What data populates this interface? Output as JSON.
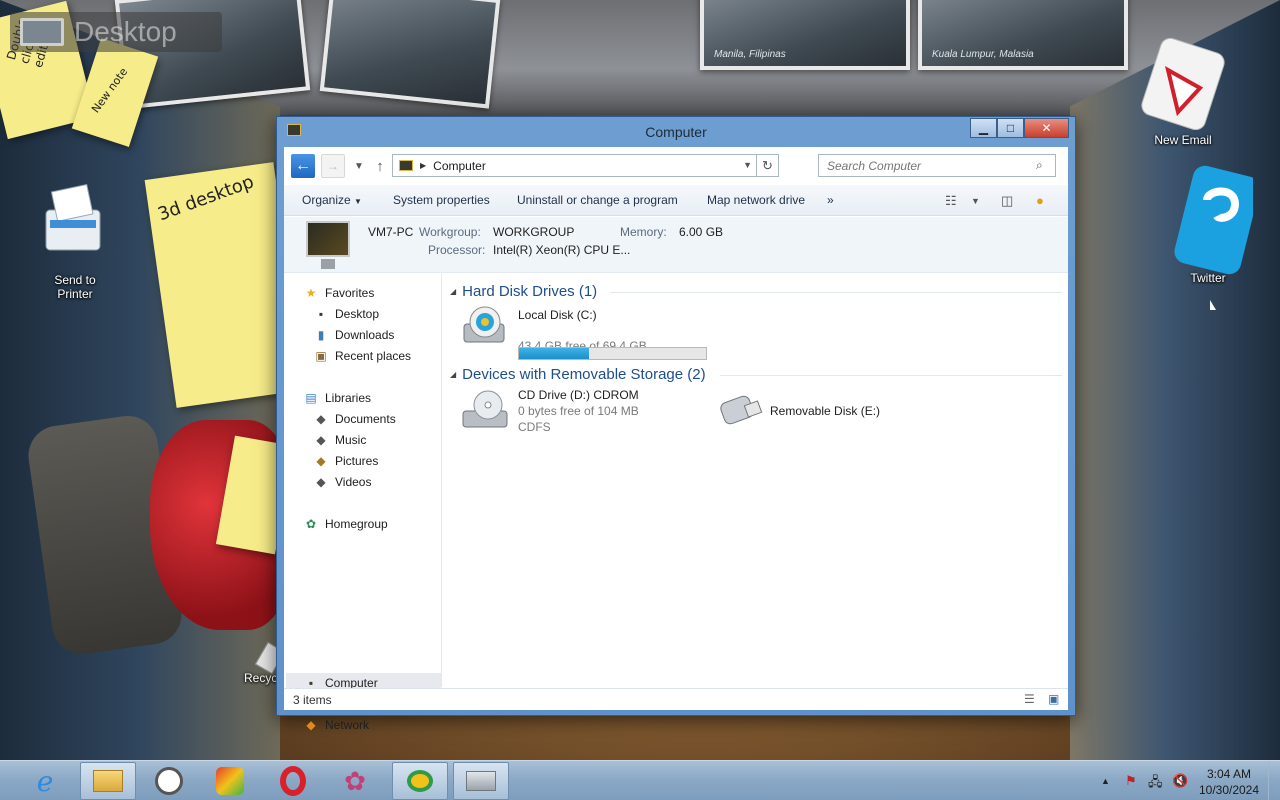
{
  "desktop": {
    "title": "Desktop",
    "notes": [
      "Double click to edit",
      "New note",
      "3d desktop"
    ],
    "icons": {
      "send_to_printer": "Send to\nPrinter",
      "new_email": "New Email",
      "twitter": "Twitter",
      "recycle": "Recyc"
    },
    "photos": [
      "Manila, Filipinas",
      "Kuala Lumpur, Malasia"
    ]
  },
  "window": {
    "title": "Computer",
    "address": {
      "path": "Computer",
      "search_placeholder": "Search Computer"
    },
    "toolbar": {
      "organize": "Organize",
      "system_properties": "System properties",
      "uninstall": "Uninstall or change a program",
      "map_drive": "Map network drive",
      "more": "»"
    },
    "details": {
      "pc_name": "VM7-PC",
      "workgroup_label": "Workgroup:",
      "workgroup": "WORKGROUP",
      "memory_label": "Memory:",
      "memory": "6.00 GB",
      "processor_label": "Processor:",
      "processor": "Intel(R) Xeon(R) CPU E..."
    },
    "nav": {
      "favorites": "Favorites",
      "desktop": "Desktop",
      "downloads": "Downloads",
      "recent": "Recent places",
      "libraries": "Libraries",
      "documents": "Documents",
      "music": "Music",
      "pictures": "Pictures",
      "videos": "Videos",
      "homegroup": "Homegroup",
      "computer": "Computer",
      "network": "Network"
    },
    "groups": {
      "hdd": "Hard Disk Drives (1)",
      "removable": "Devices with Removable Storage (2)"
    },
    "drives": {
      "c": {
        "name": "Local Disk (C:)",
        "free": "43.4 GB free of 69.4 GB",
        "used_fraction": 0.375
      },
      "d": {
        "name": "CD Drive (D:) CDROM",
        "free": "0 bytes free of 104 MB",
        "fs": "CDFS"
      },
      "e": {
        "name": "Removable Disk (E:)"
      }
    },
    "status": "3 items"
  },
  "taskbar": {
    "time": "3:04 AM",
    "date": "10/30/2024",
    "show_hidden": "▲"
  }
}
